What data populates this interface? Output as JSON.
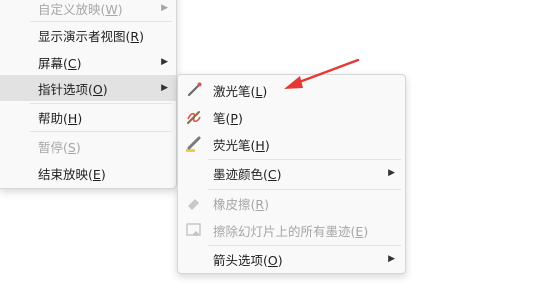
{
  "main_menu": {
    "items": [
      {
        "text": "自定义放映",
        "key": "W",
        "disabled": true,
        "submenu": true
      },
      {
        "text": "显示演示者视图",
        "key": "R",
        "disabled": false,
        "submenu": false
      },
      {
        "text": "屏幕",
        "key": "C",
        "disabled": false,
        "submenu": true
      },
      {
        "text": "指针选项",
        "key": "O",
        "disabled": false,
        "submenu": true,
        "highlighted": true
      },
      {
        "text": "帮助",
        "key": "H",
        "disabled": false,
        "submenu": false
      },
      {
        "text": "暂停",
        "key": "S",
        "disabled": true,
        "submenu": false
      },
      {
        "text": "结束放映",
        "key": "E",
        "disabled": false,
        "submenu": false
      }
    ]
  },
  "pointer_submenu": {
    "items": [
      {
        "text": "激光笔",
        "key": "L",
        "icon": "laser-pointer-icon",
        "disabled": false
      },
      {
        "text": "笔",
        "key": "P",
        "icon": "pen-icon",
        "disabled": false
      },
      {
        "text": "荧光笔",
        "key": "H",
        "icon": "highlighter-icon",
        "disabled": false
      },
      {
        "text": "墨迹颜色",
        "key": "C",
        "submenu": true,
        "disabled": false
      },
      {
        "text": "橡皮擦",
        "key": "R",
        "icon": "eraser-icon",
        "disabled": true
      },
      {
        "text": "擦除幻灯片上的所有墨迹",
        "key": "E",
        "icon": "erase-all-ink-icon",
        "disabled": true
      },
      {
        "text": "箭头选项",
        "key": "O",
        "submenu": true,
        "disabled": false
      }
    ]
  },
  "annotation": {
    "color": "#e53935",
    "icon": "red-arrow-annotation"
  }
}
